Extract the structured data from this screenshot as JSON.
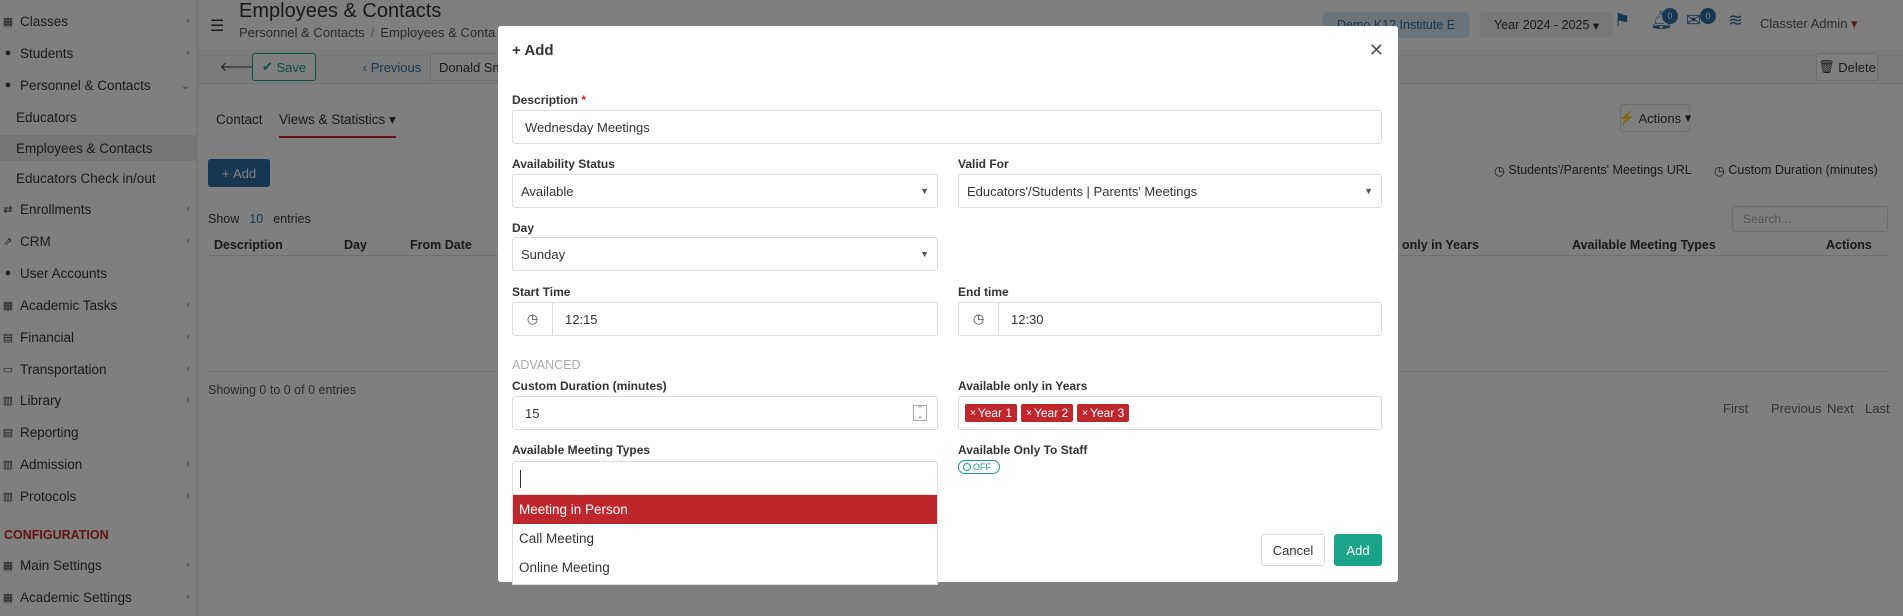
{
  "sidebar": {
    "items": [
      {
        "label": "Classes",
        "icon": "classes-icon"
      },
      {
        "label": "Students",
        "icon": "students-icon"
      },
      {
        "label": "Personnel & Contacts",
        "icon": "personnel-icon"
      },
      {
        "label": "Educators"
      },
      {
        "label": "Employees & Contacts"
      },
      {
        "label": "Educators Check in/out"
      },
      {
        "label": "Enrollments",
        "icon": "enrollments-icon"
      },
      {
        "label": "CRM",
        "icon": "crm-icon"
      },
      {
        "label": "User Accounts",
        "icon": "user-accounts-icon"
      },
      {
        "label": "Academic Tasks",
        "icon": "academic-tasks-icon"
      },
      {
        "label": "Financial",
        "icon": "financial-icon"
      },
      {
        "label": "Transportation",
        "icon": "transportation-icon"
      },
      {
        "label": "Library",
        "icon": "library-icon"
      },
      {
        "label": "Reporting",
        "icon": "reporting-icon"
      },
      {
        "label": "Admission",
        "icon": "admission-icon"
      },
      {
        "label": "Protocols",
        "icon": "protocols-icon"
      },
      {
        "label": "CONFIGURATION"
      },
      {
        "label": "Main Settings",
        "icon": "main-settings-icon"
      },
      {
        "label": "Academic Settings",
        "icon": "academic-settings-icon"
      }
    ]
  },
  "header": {
    "title": "Employees & Contacts",
    "breadcrumb": [
      "Personnel & Contacts",
      "Employees & Conta"
    ],
    "institute": "Demo K12 Institute E",
    "year": "Year 2024 - 2025",
    "notif_count": "0",
    "msg_count": "0",
    "user": "Classter Admin"
  },
  "toolbar": {
    "save_label": "Save",
    "previous_label": "Previous",
    "person": "Donald Sm",
    "delete_label": "Delete"
  },
  "tabs": {
    "contact": "Contact",
    "views": "Views & Statistics"
  },
  "content": {
    "actions_label": "Actions",
    "add_label": "Add",
    "meetings_url_label": "Students'/Parents' Meetings URL",
    "custom_duration_label": "Custom Duration (minutes)",
    "show_label": "Show",
    "show_count": "10",
    "entries_label": "entries",
    "search_placeholder": "Search...",
    "columns": [
      "Description",
      "Day",
      "From Date",
      "only in Years",
      "Available Meeting Types",
      "Actions"
    ],
    "showing": "Showing 0 to 0 of 0 entries",
    "pager": [
      "First",
      "Previous",
      "Next",
      "Last"
    ]
  },
  "modal": {
    "title": "Add",
    "description_label": "Description",
    "description_value": "Wednesday Meetings",
    "availability_label": "Availability Status",
    "availability_value": "Available",
    "valid_for_label": "Valid For",
    "valid_for_value": "Educators'/Students | Parents' Meetings",
    "day_label": "Day",
    "day_value": "Sunday",
    "start_label": "Start Time",
    "start_value": "12:15",
    "end_label": "End time",
    "end_value": "12:30",
    "advanced_label": "ADVANCED",
    "custom_duration_label": "Custom Duration (minutes)",
    "custom_duration_value": "15",
    "years_label": "Available only in Years",
    "years": [
      "Year 1",
      "Year 2",
      "Year 3"
    ],
    "meeting_types_label": "Available Meeting Types",
    "meeting_type_options": [
      "Meeting in Person",
      "Call Meeting",
      "Online Meeting"
    ],
    "staff_label": "Available Only To Staff",
    "staff_toggle": "OFF",
    "cancel_label": "Cancel",
    "add_label": "Add"
  },
  "colors": {
    "accent_red": "#c0272d",
    "accent_teal": "#1aa58a",
    "accent_blue": "#2a6fa6"
  }
}
